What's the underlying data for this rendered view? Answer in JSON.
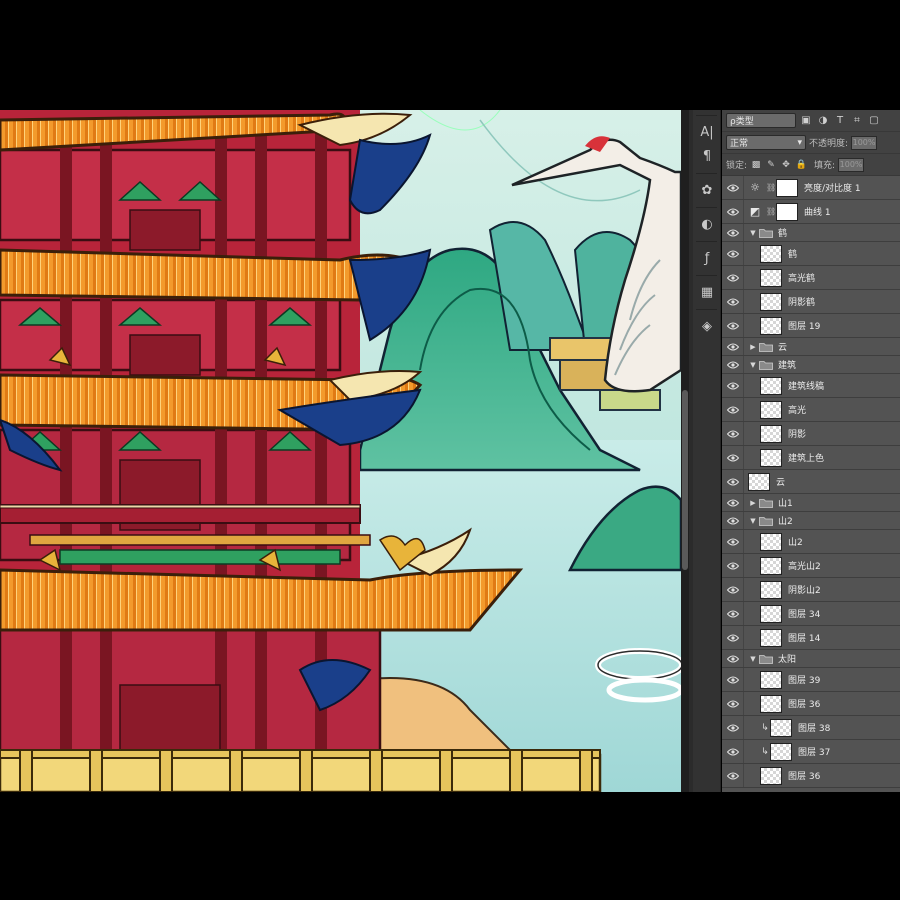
{
  "panel": {
    "filter_type": "ρ类型",
    "blend_mode": "正常",
    "opacity_label": "不透明度:",
    "opacity_value": "100%",
    "lock_label": "锁定:",
    "fill_label": "填充:",
    "fill_value": "100%"
  },
  "layers": [
    {
      "name": "亮度/对比度 1",
      "kind": "adjustment",
      "icon": "brightness-icon",
      "indent": 0
    },
    {
      "name": "曲线 1",
      "kind": "adjustment",
      "icon": "curves-icon",
      "indent": 0
    },
    {
      "name": "鹤",
      "kind": "group",
      "expanded": true,
      "indent": 0
    },
    {
      "name": "鹤",
      "kind": "layer",
      "indent": 1
    },
    {
      "name": "高光鹤",
      "kind": "layer",
      "indent": 1
    },
    {
      "name": "阴影鹤",
      "kind": "layer",
      "indent": 1
    },
    {
      "name": "图层 19",
      "kind": "layer",
      "indent": 1
    },
    {
      "name": "云",
      "kind": "group",
      "expanded": false,
      "indent": 0
    },
    {
      "name": "建筑",
      "kind": "group",
      "expanded": true,
      "indent": 0
    },
    {
      "name": "建筑线稿",
      "kind": "layer",
      "indent": 1
    },
    {
      "name": "高光",
      "kind": "layer",
      "indent": 1
    },
    {
      "name": "阴影",
      "kind": "layer",
      "indent": 1
    },
    {
      "name": "建筑上色",
      "kind": "layer",
      "indent": 1
    },
    {
      "name": "云",
      "kind": "layer",
      "indent": 0
    },
    {
      "name": "山1",
      "kind": "group",
      "expanded": false,
      "indent": 0
    },
    {
      "name": "山2",
      "kind": "group",
      "expanded": true,
      "indent": 0
    },
    {
      "name": "山2",
      "kind": "layer",
      "indent": 1
    },
    {
      "name": "高光山2",
      "kind": "layer",
      "indent": 1
    },
    {
      "name": "阴影山2",
      "kind": "layer",
      "indent": 1
    },
    {
      "name": "图层 34",
      "kind": "layer",
      "indent": 1
    },
    {
      "name": "图层 14",
      "kind": "layer",
      "indent": 1
    },
    {
      "name": "太阳",
      "kind": "group",
      "expanded": true,
      "indent": 0
    },
    {
      "name": "图层 39",
      "kind": "layer",
      "indent": 1
    },
    {
      "name": "图层 36",
      "kind": "layer",
      "indent": 1
    },
    {
      "name": "图层 38",
      "kind": "layer",
      "indent": 1,
      "clipped": true
    },
    {
      "name": "图层 37",
      "kind": "layer",
      "indent": 1,
      "clipped": true
    },
    {
      "name": "图层 36",
      "kind": "layer",
      "indent": 1
    }
  ],
  "tools": [
    "type-icon",
    "paragraph-icon",
    "swatches-icon",
    "adjustments-icon",
    "fx-icon",
    "grid-icon",
    "3d-icon"
  ]
}
